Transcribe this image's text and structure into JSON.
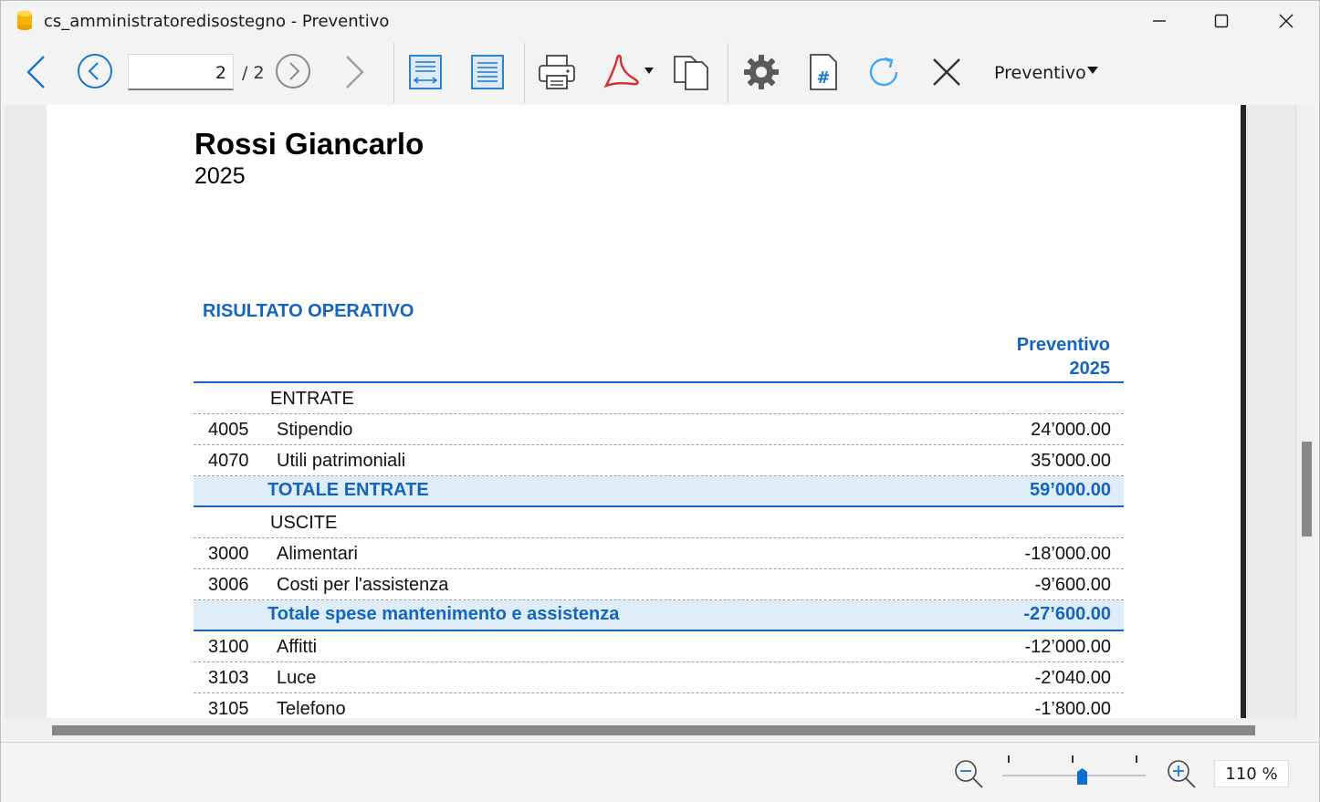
{
  "window": {
    "title": "cs_amministratoredisostegno - Preventivo"
  },
  "toolbar": {
    "current_page": "2",
    "page_total": "/ 2",
    "view_selector": "Preventivo"
  },
  "document": {
    "name": "Rossi Giancarlo",
    "year": "2025",
    "section_title": "RISULTATO OPERATIVO",
    "column_header_line1": "Preventivo",
    "column_header_line2": "2025",
    "rows": [
      {
        "type": "group",
        "account": "",
        "description": "ENTRATE",
        "amount": ""
      },
      {
        "type": "item",
        "account": "4005",
        "description": "Stipendio",
        "amount": "24’000.00"
      },
      {
        "type": "item",
        "account": "4070",
        "description": "Utili patrimoniali",
        "amount": "35’000.00"
      },
      {
        "type": "total",
        "account": "",
        "description": "TOTALE ENTRATE",
        "amount": "59’000.00"
      },
      {
        "type": "group",
        "account": "",
        "description": "USCITE",
        "amount": ""
      },
      {
        "type": "item",
        "account": "3000",
        "description": "Alimentari",
        "amount": "-18’000.00"
      },
      {
        "type": "item",
        "account": "3006",
        "description": "Costi per l'assistenza",
        "amount": "-9’600.00"
      },
      {
        "type": "total",
        "account": "",
        "description": "Totale spese mantenimento e assistenza",
        "amount": "-27’600.00"
      },
      {
        "type": "item",
        "account": "3100",
        "description": "Affitti",
        "amount": "-12’000.00"
      },
      {
        "type": "item",
        "account": "3103",
        "description": "Luce",
        "amount": "-2’040.00"
      },
      {
        "type": "item",
        "account": "3105",
        "description": "Telefono",
        "amount": "-1’800.00"
      }
    ]
  },
  "statusbar": {
    "zoom": "110 %"
  },
  "colors": {
    "accent_blue": "#1565c0",
    "total_row_bg": "#deedf7",
    "icon_blue": "#1976d2",
    "pdf_red": "#d32f2f"
  },
  "icons": [
    "app-icon",
    "back-arrow-icon",
    "previous-page-icon",
    "next-page-icon",
    "forward-arrow-icon",
    "fit-width-icon",
    "fit-page-icon",
    "print-icon",
    "pdf-icon",
    "copy-icon",
    "settings-icon",
    "page-number-icon",
    "refresh-icon",
    "close-preview-icon",
    "zoom-out-icon",
    "zoom-in-icon"
  ]
}
